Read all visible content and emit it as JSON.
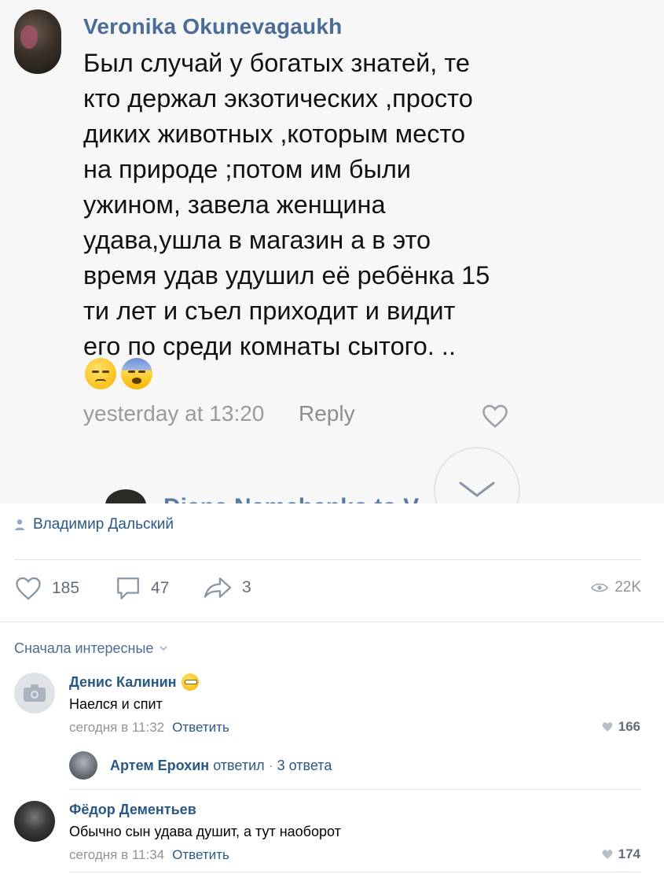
{
  "screenshot": {
    "author": "Veronika Okunevagaukh",
    "text_lines": [
      "Был случай  у богатых знатей, те",
      "кто держал экзотических ,просто",
      "диких животных ,которым место",
      "на природе ;потом им были",
      "ужином, завела женщина",
      "удава,ушла в магазин а в это",
      "время удав удушил её ребёнка 15",
      "ти лет и съел  приходит и видит",
      "его по среди комнаты сытого. .."
    ],
    "time": "yesterday at 13:20",
    "reply": "Reply",
    "cut_text": "Diana Nemchenko  to V"
  },
  "post": {
    "author": "Владимир Дальский",
    "likes": "185",
    "comments": "47",
    "shares": "3",
    "views": "22K"
  },
  "sort_label": "Сначала интересные",
  "comments": [
    {
      "name": "Денис Калинин",
      "text": "Наелся и спит",
      "time": "сегодня в 11:32",
      "reply": "Ответить",
      "likes": "166"
    },
    {
      "name": "Фёдор Дементьев",
      "text": "Обычно сын удава душит, а тут наоборот",
      "time": "сегодня в 11:34",
      "reply": "Ответить",
      "likes": "174"
    }
  ],
  "sub_reply": {
    "name": "Артем Ерохин",
    "verb": "ответил",
    "count": "3 ответа"
  },
  "colors": {
    "link": "#2a5885",
    "meta": "#939393",
    "divider": "#e1e3e6"
  }
}
